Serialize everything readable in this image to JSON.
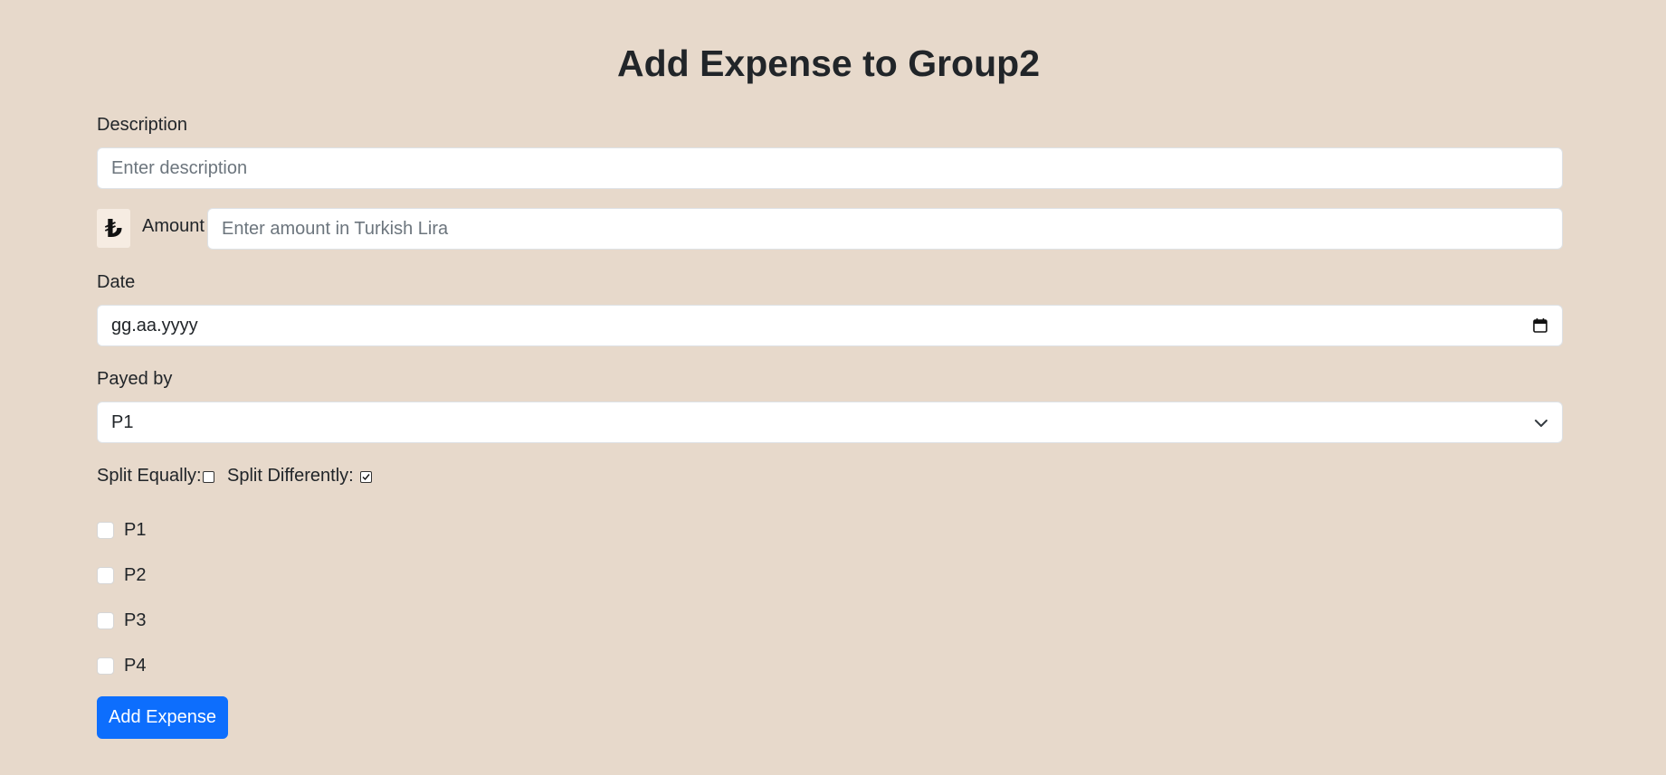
{
  "page": {
    "title": "Add Expense to Group2"
  },
  "description": {
    "label": "Description",
    "placeholder": "Enter description",
    "value": ""
  },
  "amount": {
    "currency_symbol": "₺",
    "label": "Amount",
    "placeholder": "Enter amount in Turkish Lira",
    "value": ""
  },
  "date": {
    "label": "Date",
    "display_value": "gg.aa.yyyy",
    "icon": "calendar-icon"
  },
  "payer": {
    "label": "Payed by",
    "selected": "P1",
    "icon": "chevron-down-icon"
  },
  "split": {
    "equally_label": "Split Equally:",
    "equally_checked": false,
    "differently_label": "Split Differently:",
    "differently_checked": true
  },
  "members": [
    {
      "label": "P1",
      "checked": false
    },
    {
      "label": "P2",
      "checked": false
    },
    {
      "label": "P3",
      "checked": false
    },
    {
      "label": "P4",
      "checked": false
    }
  ],
  "submit": {
    "label": "Add Expense"
  },
  "colors": {
    "background": "#e7d9cb",
    "primary_button": "#0d6efd",
    "currency_box": "#f6ece2"
  }
}
